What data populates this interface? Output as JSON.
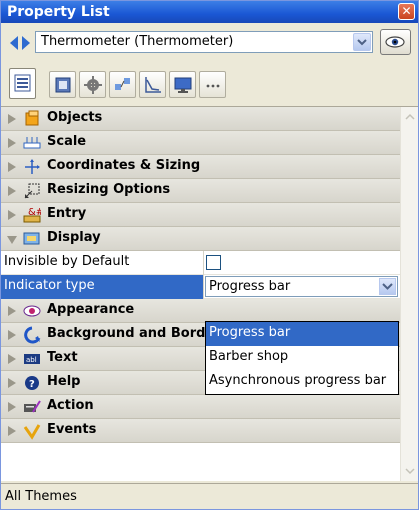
{
  "window": {
    "title": "Property List"
  },
  "selector": {
    "value": "Thermometer (Thermometer)"
  },
  "tabs": [
    {
      "icon": "list-icon",
      "active": true
    },
    {
      "icon": "object-icon"
    },
    {
      "icon": "gear-icon"
    },
    {
      "icon": "hierarchy-icon"
    },
    {
      "icon": "chart-icon"
    },
    {
      "icon": "monitor-icon"
    },
    {
      "icon": "more-icon"
    }
  ],
  "themes": [
    {
      "label": "Objects",
      "icon": "objects-icon"
    },
    {
      "label": "Scale",
      "icon": "scale-icon"
    },
    {
      "label": "Coordinates & Sizing",
      "icon": "coordinates-icon"
    },
    {
      "label": "Resizing Options",
      "icon": "resizing-icon"
    },
    {
      "label": "Entry",
      "icon": "entry-icon"
    },
    {
      "label": "Display",
      "icon": "display-icon"
    },
    {
      "label": "Appearance",
      "icon": "appearance-icon"
    },
    {
      "label": "Background and Border",
      "icon": "background-icon"
    },
    {
      "label": "Text",
      "icon": "text-icon"
    },
    {
      "label": "Help",
      "icon": "help-icon"
    },
    {
      "label": "Action",
      "icon": "action-icon"
    },
    {
      "label": "Events",
      "icon": "events-icon"
    }
  ],
  "display_props": {
    "invisible_label": "Invisible by Default",
    "indicator_label": "Indicator type",
    "indicator_value": "Progress bar"
  },
  "dropdown": {
    "options": [
      "Progress bar",
      "Barber shop",
      "Asynchronous progress bar"
    ],
    "selected_index": 0
  },
  "status": {
    "text": "All Themes"
  }
}
